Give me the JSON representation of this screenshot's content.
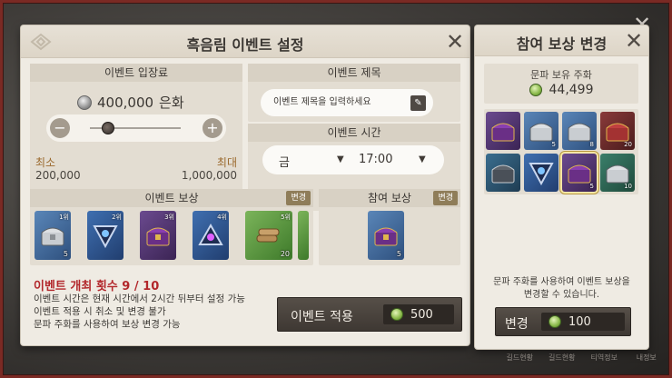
{
  "background": {
    "close_label": "✕",
    "bottom_bar": [
      "길드현황",
      "길드현황",
      "티역정보",
      "내정보"
    ]
  },
  "dialog": {
    "title": "흑음림 이벤트 설정",
    "close_label": "✕",
    "entry_fee": {
      "header": "이벤트 입장료",
      "value": "400,000",
      "currency": "은화",
      "minus_label": "−",
      "plus_label": "+",
      "slider_fraction": 0.2,
      "min_label": "최소",
      "min_value": "200,000",
      "max_label": "최대",
      "max_value": "1,000,000"
    },
    "event_title": {
      "header": "이벤트 제목",
      "placeholder": "이벤트 제목을 입력하세요",
      "edit_icon": "pencil-icon"
    },
    "event_time": {
      "header": "이벤트 시간",
      "day": "금",
      "hour": "17:00"
    },
    "event_reward": {
      "header": "이벤트 보상",
      "change_label": "변경",
      "items": [
        {
          "icon": "silver-chest-icon",
          "grade": "1위",
          "qty": "5"
        },
        {
          "icon": "blue-triangle-banner-icon",
          "grade": "2위",
          "qty": ""
        },
        {
          "icon": "purple-chest-icon",
          "grade": "3위",
          "qty": ""
        },
        {
          "icon": "blue-orb-banner-icon",
          "grade": "4위",
          "qty": ""
        },
        {
          "icon": "wood-logs-icon",
          "grade": "5위",
          "qty": "20"
        }
      ]
    },
    "participation_reward": {
      "header": "참여 보상",
      "change_label": "변경",
      "item": {
        "icon": "purple-chest-icon",
        "qty": "5"
      }
    },
    "event_count": "이벤트 개최 횟수 9 / 10",
    "notes": [
      "이벤트 시간은 현재 시간에서 2시간 뒤부터 설정 가능",
      "이벤트 적용 시 취소 및 변경 불가",
      "문파 주화를 사용하여 보상 변경 가능"
    ],
    "apply_button": {
      "label": "이벤트 적용",
      "cost": "500"
    }
  },
  "side": {
    "title": "참여 보상 변경",
    "close_label": "✕",
    "coin_label": "문파 보유 주화",
    "coin_value": "44,499",
    "items": [
      {
        "icon": "purple-chest-icon",
        "qty": ""
      },
      {
        "icon": "silver-chest-icon",
        "qty": "5"
      },
      {
        "icon": "silver-chest-icon",
        "qty": "8"
      },
      {
        "icon": "red-chest-icon",
        "qty": "20"
      },
      {
        "icon": "dark-chest-icon",
        "qty": ""
      },
      {
        "icon": "blue-triangle-banner-icon",
        "qty": ""
      },
      {
        "icon": "purple-chest-icon",
        "qty": "5"
      },
      {
        "icon": "silver-chest-icon",
        "qty": "10"
      }
    ],
    "selected_index": 6,
    "note": "문파 주화를 사용하여 이벤트 보상을 변경할 수 있습니다.",
    "change_button": {
      "label": "변경",
      "cost": "100"
    }
  }
}
